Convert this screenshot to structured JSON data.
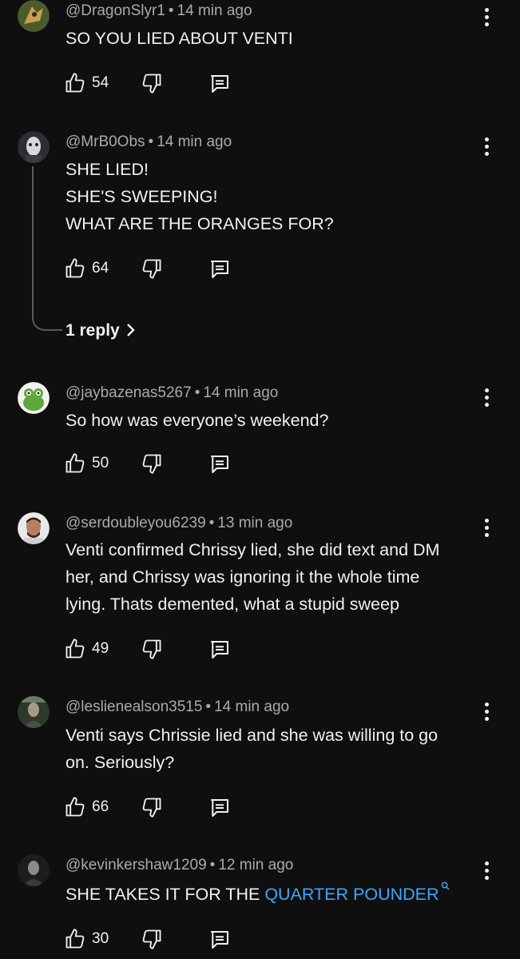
{
  "comments": [
    {
      "handle": "@DragonSlyr1",
      "time": "14 min ago",
      "lines": [
        "SO YOU LIED ABOUT VENTI"
      ],
      "likes": "54",
      "avatar_colors": [
        "#4d5a2c",
        "#c9a14b"
      ]
    },
    {
      "handle": "@MrB0Obs",
      "time": "14 min ago",
      "lines": [
        "SHE LIED!",
        "SHE'S SWEEPING!",
        "WHAT ARE THE ORANGES FOR?"
      ],
      "likes": "64",
      "replies_label": "1 reply",
      "avatar_colors": [
        "#2a2f33",
        "#d8d8d8"
      ]
    },
    {
      "handle": "@jaybazenas5267",
      "time": "14 min ago",
      "lines": [
        "So how was everyone’s weekend?"
      ],
      "likes": "50",
      "avatar_colors": [
        "#f2f2f2",
        "#5ea83b"
      ]
    },
    {
      "handle": "@serdoubleyou6239",
      "time": "13 min ago",
      "lines": [
        "Venti confirmed Chrissy lied, she did text and DM",
        "her, and Chrissy was ignoring it the whole time",
        "lying. Thats demented, what a stupid sweep"
      ],
      "likes": "49",
      "avatar_colors": [
        "#e9e9e9",
        "#b57f5e"
      ]
    },
    {
      "handle": "@leslienealson3515",
      "time": "14 min ago",
      "lines": [
        "Venti says Chrissie lied and she was willing to go",
        "on.  Seriously?"
      ],
      "likes": "66",
      "avatar_colors": [
        "#2b3a2b",
        "#6a7d64"
      ]
    },
    {
      "handle": "@kevinkershaw1209",
      "time": "12 min ago",
      "text_prefix": "SHE TAKES IT FOR THE ",
      "text_link": "QUARTER POUNDER",
      "likes": "30",
      "avatar_colors": [
        "#1d1d1d",
        "#8a8a8a"
      ]
    }
  ],
  "colors": {
    "background": "#0f0f0f",
    "text": "#f1f1f1",
    "secondary_text": "#aaaaaa",
    "link": "#3ea6ff"
  },
  "icons": [
    "thumbs-up-icon",
    "thumbs-down-icon",
    "reply-icon",
    "more-vert-icon",
    "chevron-right-icon",
    "search-icon"
  ]
}
